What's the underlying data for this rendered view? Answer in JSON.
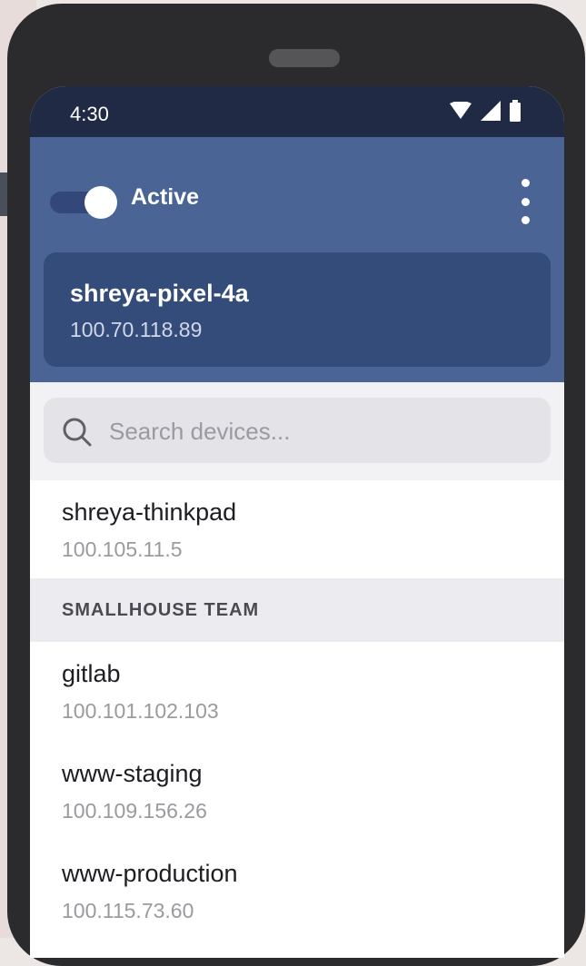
{
  "status_bar": {
    "time": "4:30"
  },
  "header": {
    "toggle_label": "Active",
    "current_device": {
      "name": "shreya-pixel-4a",
      "ip": "100.70.118.89"
    }
  },
  "search": {
    "placeholder": "Search devices..."
  },
  "my_devices": [
    {
      "name": "shreya-thinkpad",
      "ip": "100.105.11.5"
    }
  ],
  "team_section": {
    "title": "SMALLHOUSE TEAM",
    "devices": [
      {
        "name": "gitlab",
        "ip": "100.101.102.103"
      },
      {
        "name": "www-staging",
        "ip": "100.109.156.26"
      },
      {
        "name": "www-production",
        "ip": "100.115.73.60"
      }
    ]
  },
  "colors": {
    "header_bg": "#4b6496",
    "card_bg": "#344c7a",
    "statusbar_bg": "#202a44"
  }
}
